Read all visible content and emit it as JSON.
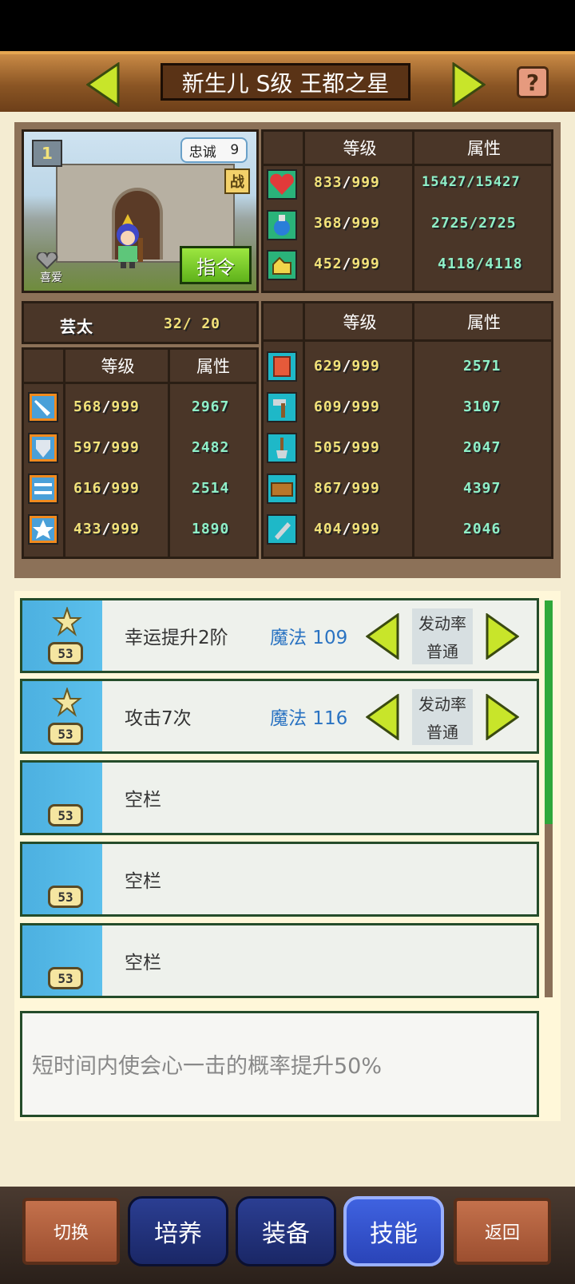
{
  "header": {
    "title": "新生儿 S级 王都之星"
  },
  "character": {
    "loyalty_label": "忠诚",
    "loyalty_value": "9",
    "battle_label": "战",
    "command_label": "指令",
    "like_label": "喜爱",
    "level_badge": "1",
    "name_glyph": "芸太",
    "count": "32/ 20"
  },
  "top_stats": {
    "col_level": "等级",
    "col_attr": "属性",
    "rows": [
      {
        "icon": "heart-icon",
        "level": "833",
        "max": "999",
        "attr": "15427/15427"
      },
      {
        "icon": "potion-icon",
        "level": "368",
        "max": "999",
        "attr": "2725/2725"
      },
      {
        "icon": "strength-icon",
        "level": "452",
        "max": "999",
        "attr": "4118/4118"
      }
    ]
  },
  "left_stats": {
    "col_level": "等级",
    "col_attr": "属性",
    "rows": [
      {
        "icon": "sword-icon",
        "level": "568",
        "max": "999",
        "attr": "2967"
      },
      {
        "icon": "shield-icon",
        "level": "597",
        "max": "999",
        "attr": "2482"
      },
      {
        "icon": "arrows-icon",
        "level": "616",
        "max": "999",
        "attr": "2514"
      },
      {
        "icon": "star-icon",
        "level": "433",
        "max": "999",
        "attr": "1890"
      }
    ]
  },
  "right_stats": {
    "col_level": "等级",
    "col_attr": "属性",
    "rows": [
      {
        "icon": "book-icon",
        "level": "629",
        "max": "999",
        "attr": "2571"
      },
      {
        "icon": "hammer-icon",
        "level": "609",
        "max": "999",
        "attr": "3107"
      },
      {
        "icon": "shovel-icon",
        "level": "505",
        "max": "999",
        "attr": "2047"
      },
      {
        "icon": "chest-icon",
        "level": "867",
        "max": "999",
        "attr": "4397"
      },
      {
        "icon": "tool-icon",
        "level": "404",
        "max": "999",
        "attr": "2046"
      }
    ]
  },
  "skills": {
    "badge": "53",
    "rate_label": "发动率",
    "rate_value": "普通",
    "rows": [
      {
        "name": "幸运提升2阶",
        "magic": "魔法 109"
      },
      {
        "name": "攻击7次",
        "magic": "魔法 116"
      },
      {
        "name": "空栏"
      },
      {
        "name": "空栏"
      },
      {
        "name": "空栏"
      }
    ]
  },
  "description": "短时间内使会心一击的概率提升50%",
  "bottom_nav": {
    "switch": "切换",
    "train": "培养",
    "equip": "装备",
    "skill": "技能",
    "back": "返回"
  },
  "colors": {
    "accent_green": "#9ce640",
    "magic_blue": "#2a73c2",
    "active_tab": "#3f62e0"
  }
}
